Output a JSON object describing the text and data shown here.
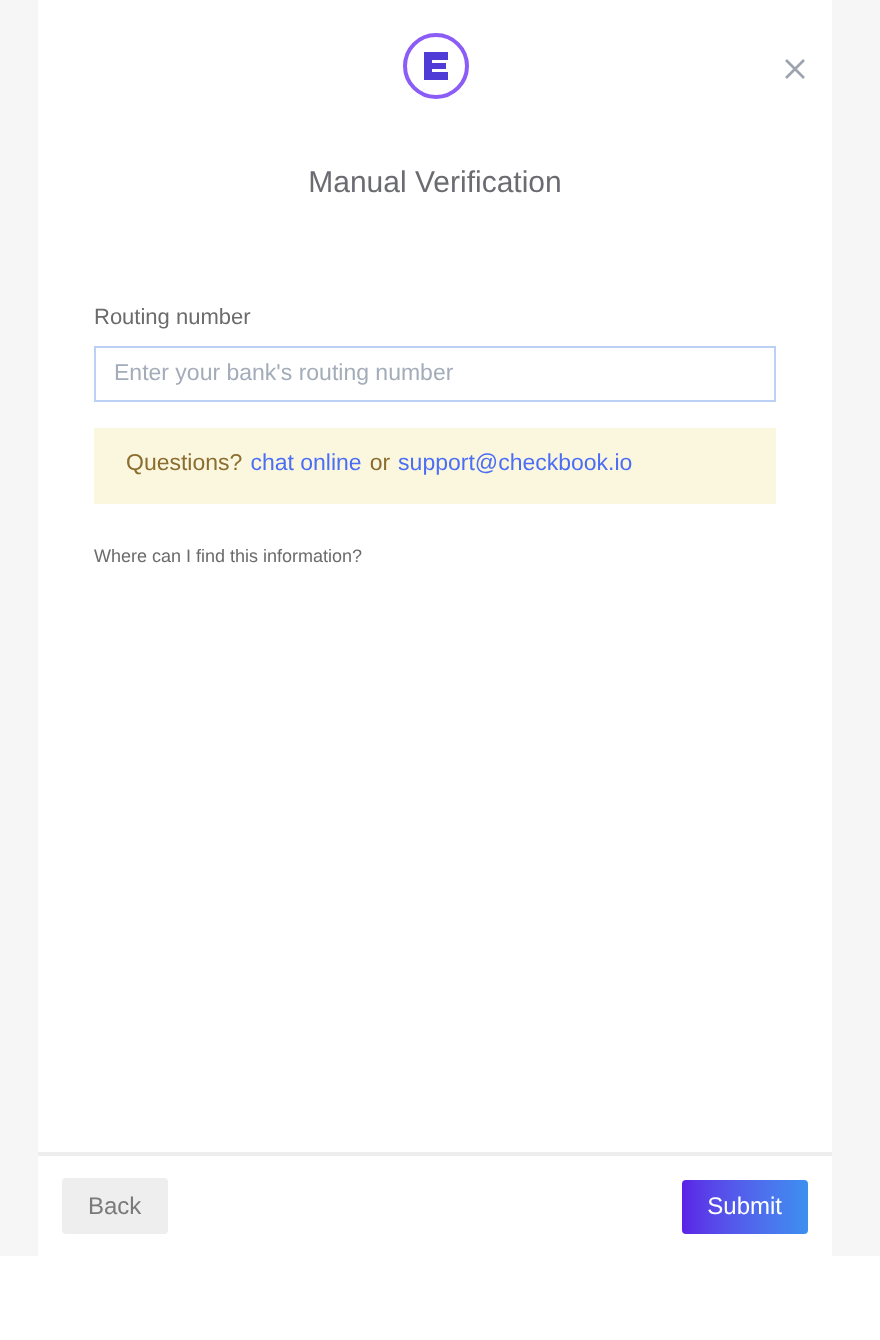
{
  "title": "Manual Verification",
  "field": {
    "label": "Routing number",
    "placeholder": "Enter your bank's routing number"
  },
  "notice": {
    "lead": "Questions?",
    "link_1": "chat online",
    "joiner": "or",
    "link_2": "support@checkbook.io"
  },
  "help_link": "Where can I find this information?",
  "buttons": [
    {
      "kind": "secondary",
      "label": "Back"
    },
    {
      "kind": "primary",
      "label": "Submit"
    }
  ]
}
